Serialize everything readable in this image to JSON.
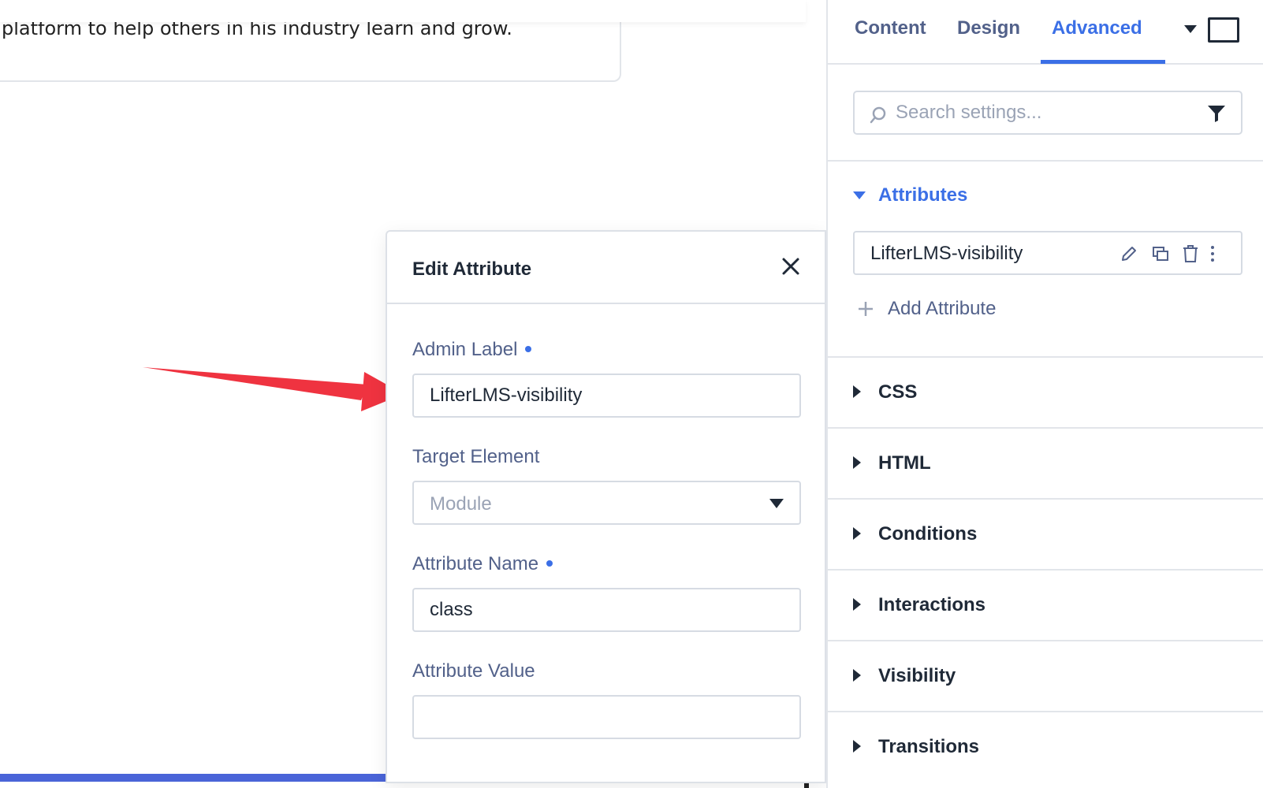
{
  "canvas": {
    "card_text": "platform to help others in his industry learn and grow."
  },
  "modal": {
    "title": "Edit Attribute",
    "fields": {
      "admin_label": {
        "label": "Admin Label",
        "value": "LifterLMS-visibility"
      },
      "target_element": {
        "label": "Target Element",
        "value": "Module"
      },
      "attribute_name": {
        "label": "Attribute Name",
        "value": "class"
      },
      "attribute_value": {
        "label": "Attribute Value",
        "value": ""
      }
    }
  },
  "panel": {
    "tabs": [
      {
        "label": "Content"
      },
      {
        "label": "Design"
      },
      {
        "label": "Advanced"
      }
    ],
    "active_tab": "Advanced",
    "search": {
      "placeholder": "Search settings..."
    },
    "attributes": {
      "title": "Attributes",
      "items": [
        {
          "label": "LifterLMS-visibility"
        }
      ],
      "add_label": "Add Attribute"
    },
    "sections": [
      {
        "label": "CSS"
      },
      {
        "label": "HTML"
      },
      {
        "label": "Conditions"
      },
      {
        "label": "Interactions"
      },
      {
        "label": "Visibility"
      },
      {
        "label": "Transitions"
      }
    ]
  },
  "colors": {
    "accent": "#3b6fe6",
    "arrow": "#ef3340",
    "label": "#52618a",
    "border": "#d6dbe3"
  }
}
